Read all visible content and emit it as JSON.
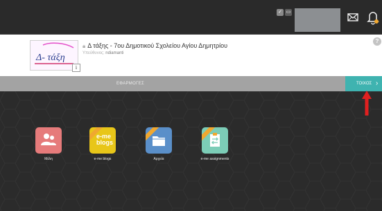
{
  "header": {
    "title": "Δ τάξης - 7ου Δημοτικού Σχολείου Αγίου Δημητρίου",
    "owner_label": "Υπεύθυνος:",
    "owner_name": "ndiamanti",
    "logo_text": "Δ- τάξη",
    "info_glyph": "i"
  },
  "help_glyph": "?",
  "tabs": {
    "apps_label": "ΕΦΑΡΜΟΓΕΣ",
    "wall_label": "ΤΟΙΧΟΣ",
    "wall_chevron": "›"
  },
  "apps": [
    {
      "label": "Μέλη",
      "color": "#e67b7b",
      "icon": "members-icon"
    },
    {
      "label": "e-me blogs",
      "color": "#e8c619",
      "icon": "blogs-icon",
      "icon_text": "e-me blogs"
    },
    {
      "label": "Αρχεία",
      "color": "#5a8fc9",
      "icon": "folder-icon"
    },
    {
      "label": "e-me assignments",
      "color": "#7ccdb7",
      "icon": "assignments-icon"
    }
  ],
  "colors": {
    "accent_teal": "#3fb3b0",
    "tab_bar_grey": "#a3a3a3",
    "background_dark": "#2b2b2b",
    "annotation_red": "#e02020"
  }
}
